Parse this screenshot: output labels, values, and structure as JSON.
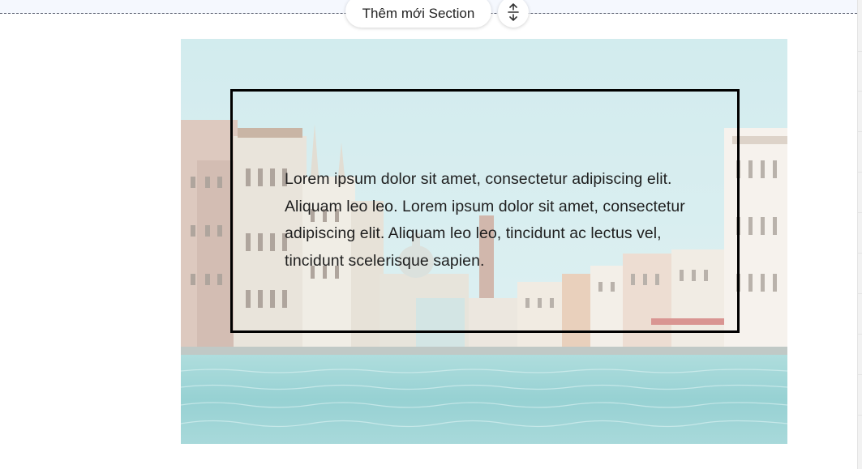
{
  "toolbar": {
    "add_section_label": "Thêm mới Section",
    "resize_icon": "vertical-resize-icon"
  },
  "banner": {
    "image": "venice-grand-canal-photo",
    "text": "Lorem ipsum dolor sit amet, consectetur adipiscing elit. Aliquam leo leo. Lorem ipsum dolor sit amet, consectetur adipiscing elit. Aliquam leo leo, tincidunt ac lectus vel, tincidunt scelerisque sapien."
  },
  "colors": {
    "sky": "#bfe3e6",
    "water": "#6fc4c6",
    "frame": "#000000",
    "text": "#1f1f1f"
  }
}
